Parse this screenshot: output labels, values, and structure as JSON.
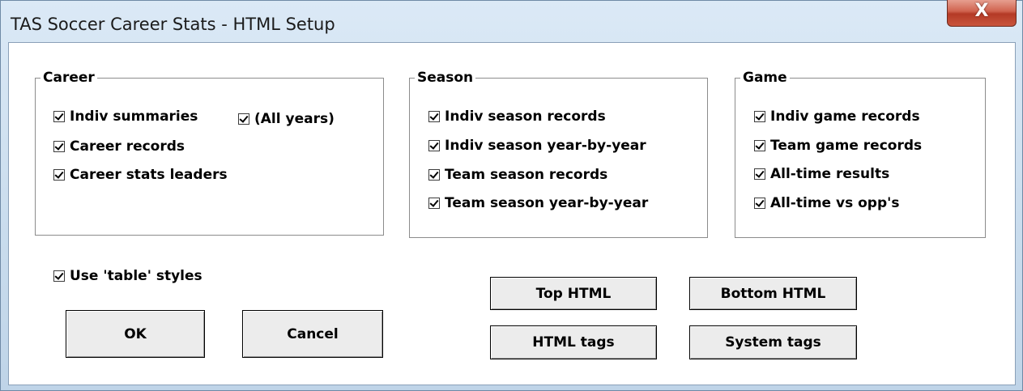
{
  "window": {
    "title": "TAS Soccer Career Stats - HTML Setup",
    "close_glyph": "X"
  },
  "career": {
    "title": "Career",
    "items": [
      {
        "label": "Indiv summaries",
        "checked": true
      },
      {
        "label": "(All years)",
        "checked": true
      },
      {
        "label": "Career records",
        "checked": true
      },
      {
        "label": "Career stats leaders",
        "checked": true
      }
    ]
  },
  "season": {
    "title": "Season",
    "items": [
      {
        "label": "Indiv season records",
        "checked": true
      },
      {
        "label": "Indiv season year-by-year",
        "checked": true
      },
      {
        "label": "Team season records",
        "checked": true
      },
      {
        "label": "Team season year-by-year",
        "checked": true
      }
    ]
  },
  "game": {
    "title": "Game",
    "items": [
      {
        "label": "Indiv game records",
        "checked": true
      },
      {
        "label": "Team game records",
        "checked": true
      },
      {
        "label": "All-time results",
        "checked": true
      },
      {
        "label": "All-time vs opp's",
        "checked": true
      }
    ]
  },
  "options": {
    "use_table_styles": {
      "label": "Use 'table' styles",
      "checked": true
    }
  },
  "buttons": {
    "ok": "OK",
    "cancel": "Cancel",
    "top_html": "Top HTML",
    "bottom_html": "Bottom HTML",
    "html_tags": "HTML tags",
    "system_tags": "System tags"
  }
}
